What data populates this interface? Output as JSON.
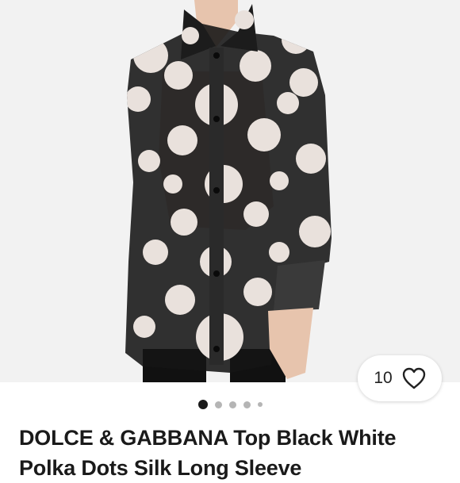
{
  "listing": {
    "title_line1": "DOLCE & GABBANA Top Black White",
    "title_line2": "Polka Dots Silk Long Sleeve",
    "like_count": "10",
    "image_subject": "Model wearing sheer black blouse with large white polka dots",
    "carousel": {
      "total": 5,
      "active_index": 0
    }
  },
  "icons": {
    "like": "heart-outline-icon"
  },
  "colors": {
    "background": "#ffffff",
    "photo_backdrop": "#f2f2f2",
    "fabric": "#141414",
    "dot": "#e9e1dc",
    "active_dot": "#1a1a1a",
    "inactive_dot": "#b5b5b5"
  }
}
